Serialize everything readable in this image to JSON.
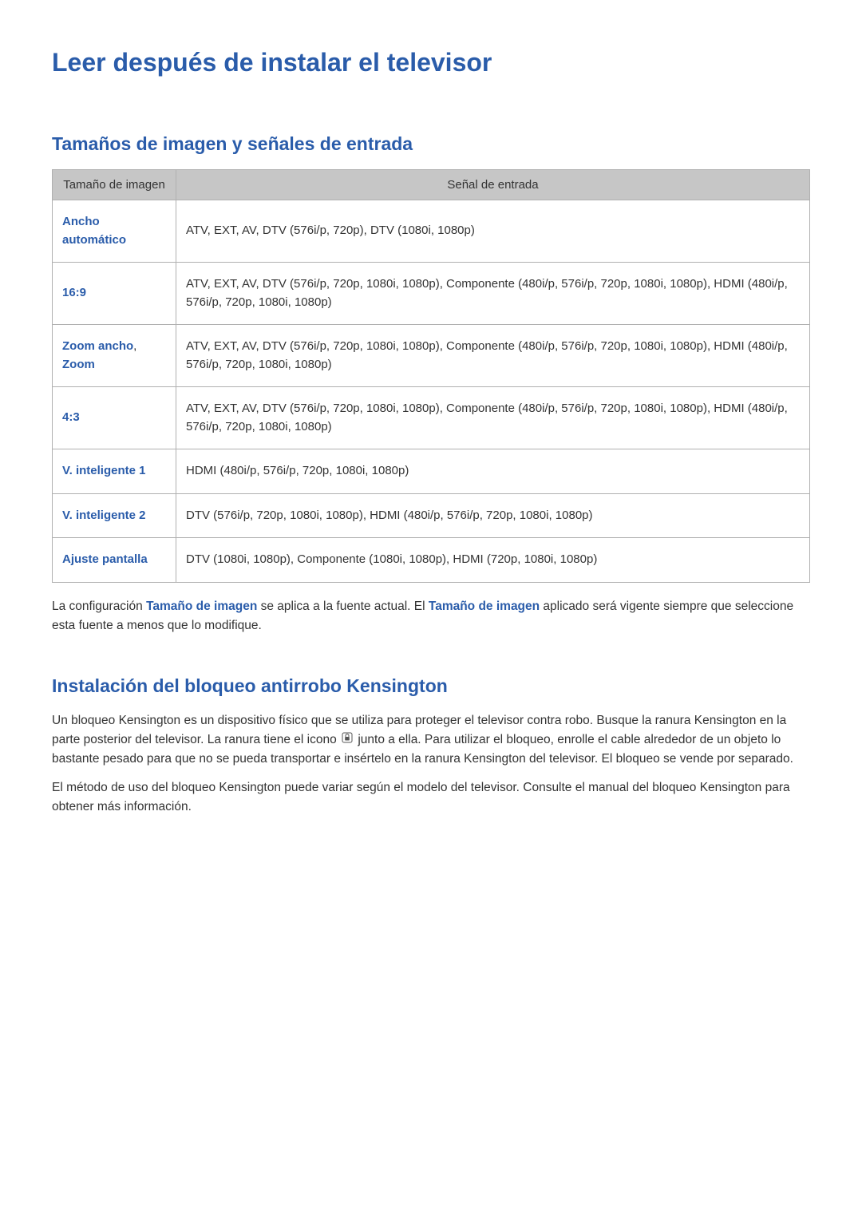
{
  "page_title": "Leer después de instalar el televisor",
  "section1": {
    "title": "Tamaños de imagen y señales de entrada",
    "table": {
      "headers": [
        "Tamaño de imagen",
        "Señal de entrada"
      ],
      "rows": [
        {
          "label": "Ancho automático",
          "signal": "ATV, EXT, AV, DTV (576i/p, 720p), DTV (1080i, 1080p)"
        },
        {
          "label": "16:9",
          "signal": "ATV, EXT, AV, DTV (576i/p, 720p, 1080i, 1080p), Componente (480i/p, 576i/p, 720p, 1080i, 1080p), HDMI (480i/p, 576i/p, 720p, 1080i, 1080p)"
        },
        {
          "label_part1": "Zoom ancho",
          "label_sep": ", ",
          "label_part2": "Zoom",
          "signal": "ATV, EXT, AV, DTV (576i/p, 720p, 1080i, 1080p), Componente (480i/p, 576i/p, 720p, 1080i, 1080p), HDMI (480i/p, 576i/p, 720p, 1080i, 1080p)"
        },
        {
          "label": "4:3",
          "signal": "ATV, EXT, AV, DTV (576i/p, 720p, 1080i, 1080p), Componente (480i/p, 576i/p, 720p, 1080i, 1080p), HDMI (480i/p, 576i/p, 720p, 1080i, 1080p)"
        },
        {
          "label": "V. inteligente 1",
          "signal": "HDMI (480i/p, 576i/p, 720p, 1080i, 1080p)"
        },
        {
          "label": "V. inteligente 2",
          "signal": "DTV (576i/p, 720p, 1080i, 1080p), HDMI (480i/p, 576i/p, 720p, 1080i, 1080p)"
        },
        {
          "label": "Ajuste pantalla",
          "signal": "DTV (1080i, 1080p), Componente (1080i, 1080p), HDMI (720p, 1080i, 1080p)"
        }
      ]
    },
    "note": {
      "p1_a": "La configuración ",
      "p1_b": "Tamaño de imagen",
      "p1_c": " se aplica a la fuente actual. El ",
      "p1_d": "Tamaño de imagen",
      "p1_e": " aplicado será vigente siempre que seleccione esta fuente a menos que lo modifique."
    }
  },
  "section2": {
    "title": "Instalación del bloqueo antirrobo Kensington",
    "p1_a": "Un bloqueo Kensington es un dispositivo físico que se utiliza para proteger el televisor contra robo. Busque la ranura Kensington en la parte posterior del televisor. La ranura tiene el icono ",
    "p1_b": " junto a ella. Para utilizar el bloqueo, enrolle el cable alrededor de un objeto lo bastante pesado para que no se pueda transportar e insértelo en la ranura Kensington del televisor. El bloqueo se vende por separado.",
    "p2": "El método de uso del bloqueo Kensington puede variar según el modelo del televisor. Consulte el manual del bloqueo Kensington para obtener más información.",
    "icon_name": "kensington-lock-icon"
  }
}
